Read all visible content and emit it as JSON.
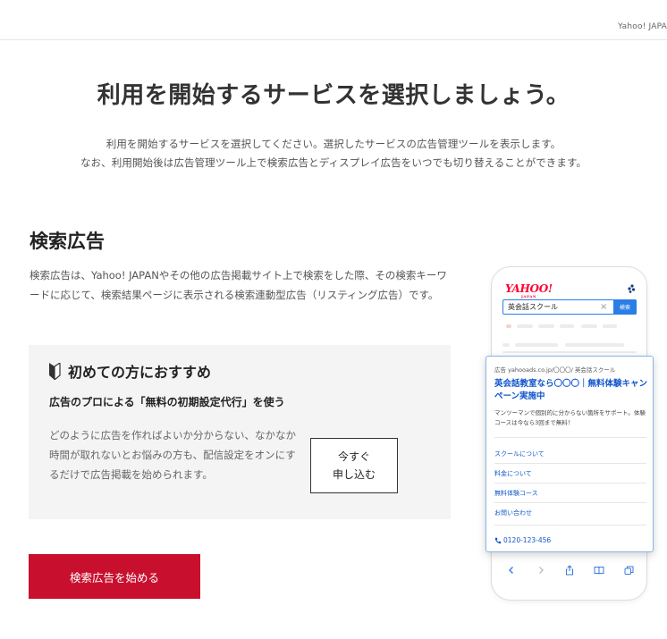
{
  "header": {
    "brand": "Yahoo! JAPA"
  },
  "page": {
    "title": "利用を開始するサービスを選択しましょう。",
    "intro_line1": "利用を開始するサービスを選択してください。選択したサービスの広告管理ツールを表示します。",
    "intro_line2": "なお、利用開始後は広告管理ツール上で検索広告とディスプレイ広告をいつでも切り替えることができます。"
  },
  "search_ads": {
    "title": "検索広告",
    "description": "検索広告は、Yahoo! JAPANやその他の広告掲載サイト上で検索をした際、その検索キーワードに応じて、検索結果ページに表示される検索連動型広告（リスティング広告）です。",
    "recommend": {
      "heading": "初めての方におすすめ",
      "subheading": "広告のプロによる「無料の初期設定代行」を使う",
      "text": "どのように広告を作ればよいか分からない、なかなか時間が取れないとお悩みの方も、配信設定をオンにするだけで広告掲載を始められます。",
      "button_line1": "今すぐ",
      "button_line2": "申し込む"
    },
    "start_button": "検索広告を始める"
  },
  "phone_mockup": {
    "logo": "YAHOO!",
    "logo_sub": "JAPAN",
    "search_query": "英会話スクール",
    "search_button": "検索",
    "ad": {
      "url": "広告 yahooads.co.jp/〇〇〇/ 英会話スクール",
      "headline": "英会話教室なら〇〇〇｜無料体験キャンペーン実施中",
      "description": "マンツーマンで個別的に分からない箇所をサポート。体験コースは今なら3回まで無料！",
      "links": [
        "スクールについて",
        "料金について",
        "無料体験コース",
        "お問い合わせ"
      ],
      "phone": "0120-123-456"
    }
  },
  "colors": {
    "accent_red": "#c8102e",
    "link_blue": "#1155cc",
    "search_blue": "#2a7ee6"
  },
  "icons": [
    "beginner-mark-icon",
    "apps-icon",
    "close-icon",
    "phone-icon",
    "back-icon",
    "forward-icon",
    "share-icon",
    "bookmarks-icon",
    "tabs-icon"
  ]
}
